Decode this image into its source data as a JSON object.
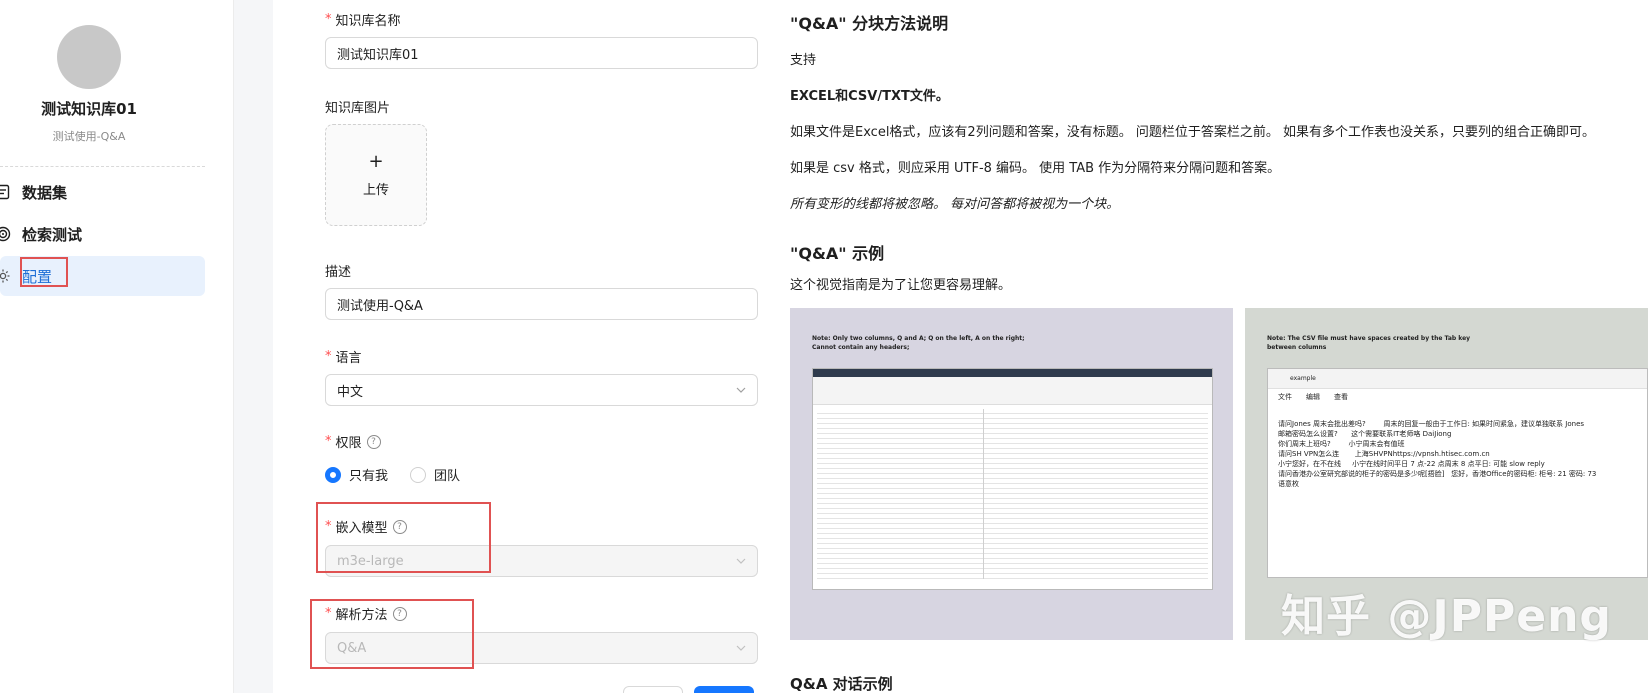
{
  "sidebar": {
    "kb_name": "测试知识库01",
    "kb_subtitle": "测试使用-Q&A",
    "items": [
      {
        "label": "数据集",
        "icon": "file-icon"
      },
      {
        "label": "检索测试",
        "icon": "target-icon"
      },
      {
        "label": "配置",
        "icon": "gear-icon",
        "active": true
      }
    ]
  },
  "form": {
    "name_label": "知识库名称",
    "name_value": "测试知识库01",
    "image_label": "知识库图片",
    "upload_label": "上传",
    "desc_label": "描述",
    "desc_value": "测试使用-Q&A",
    "lang_label": "语言",
    "lang_value": "中文",
    "perm_label": "权限",
    "perm_options": [
      "只有我",
      "团队"
    ],
    "perm_selected": "只有我",
    "embed_label": "嵌入模型",
    "embed_value": "m3e-large",
    "parse_label": "解析方法",
    "parse_value": "Q&A"
  },
  "doc": {
    "title1": "\"Q&A\" 分块方法说明",
    "p_support": "支持",
    "p_formats": "EXCEL和CSV/TXT文件。",
    "p_excel": "如果文件是Excel格式，应该有2列问题和答案，没有标题。 问题栏位于答案栏之前。 如果有多个工作表也没关系，只要列的组合正确即可。",
    "p_csv": "如果是 csv 格式，则应采用 UTF-8 编码。 使用 TAB 作为分隔符来分隔问题和答案。",
    "p_ignore": "所有变形的线都将被忽略。 每对问答都将被视为一个块。",
    "title2": "\"Q&A\" 示例",
    "p_visual": "这个视觉指南是为了让您更容易理解。",
    "img1_note": "Note: Only two columns, Q and A; Q on the left, A on the right;\nCannot contain any headers;",
    "img2_note": "Note: The CSV file must have spaces created by the Tab key\nbetween columns",
    "img2_tab": "example",
    "img2_menu": [
      "文件",
      "编辑",
      "查看"
    ],
    "img2_body": "请问Jones 周末会批出差吗?        周末的回复一般由于工作日: 如果时间紧急，建议单独联系 Jones\n邮箱密码怎么设置?      这个需要联系IT老师咯 DaiJiong\n你们周末上班吗?        小宁周末会有值班\n请问SH VPN怎么连       上海SHVPNhttps://vpnsh.htisec.com.cn\n小宁您好，在不在线     小宁在线时间平日 7 点-22 点周末 8 点平日: 可能 slow reply\n请问香港办公室研究部说的柜子的密码是多少呢[捂脸]   您好，香港Office的密码柜: 柜号: 21 密码: 73\n语意枚",
    "watermark": "知乎 @JPPeng",
    "title3": "Q&A 对话示例"
  },
  "colors": {
    "accent": "#1677ff",
    "highlight_box": "#e05252",
    "required": "#ff4d4f"
  }
}
